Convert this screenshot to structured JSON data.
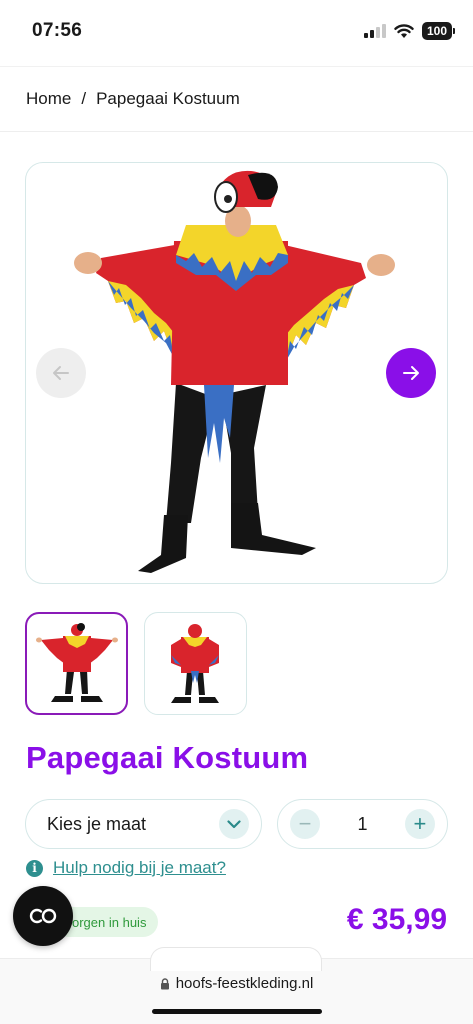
{
  "status_bar": {
    "time": "07:56",
    "battery": "100"
  },
  "breadcrumb": {
    "home": "Home",
    "separator": "/",
    "current": "Papegaai Kostuum"
  },
  "gallery": {
    "prev_icon": "arrow-left-icon",
    "next_icon": "arrow-right-icon"
  },
  "product": {
    "title": "Papegaai Kostuum",
    "size_select": {
      "value": "Kies je maat"
    },
    "quantity": {
      "value": "1",
      "minus": "−",
      "plus": "+"
    },
    "help": {
      "icon": "i",
      "link": "Hulp nodig bij je maat?"
    },
    "delivery": "orgen in huis",
    "price": "€ 35,99"
  },
  "browser": {
    "url": "hoofs-feestkleding.nl"
  },
  "colors": {
    "brand": "#8a0fe8",
    "teal": "#2e8f8f",
    "border": "#d6e8e8"
  }
}
